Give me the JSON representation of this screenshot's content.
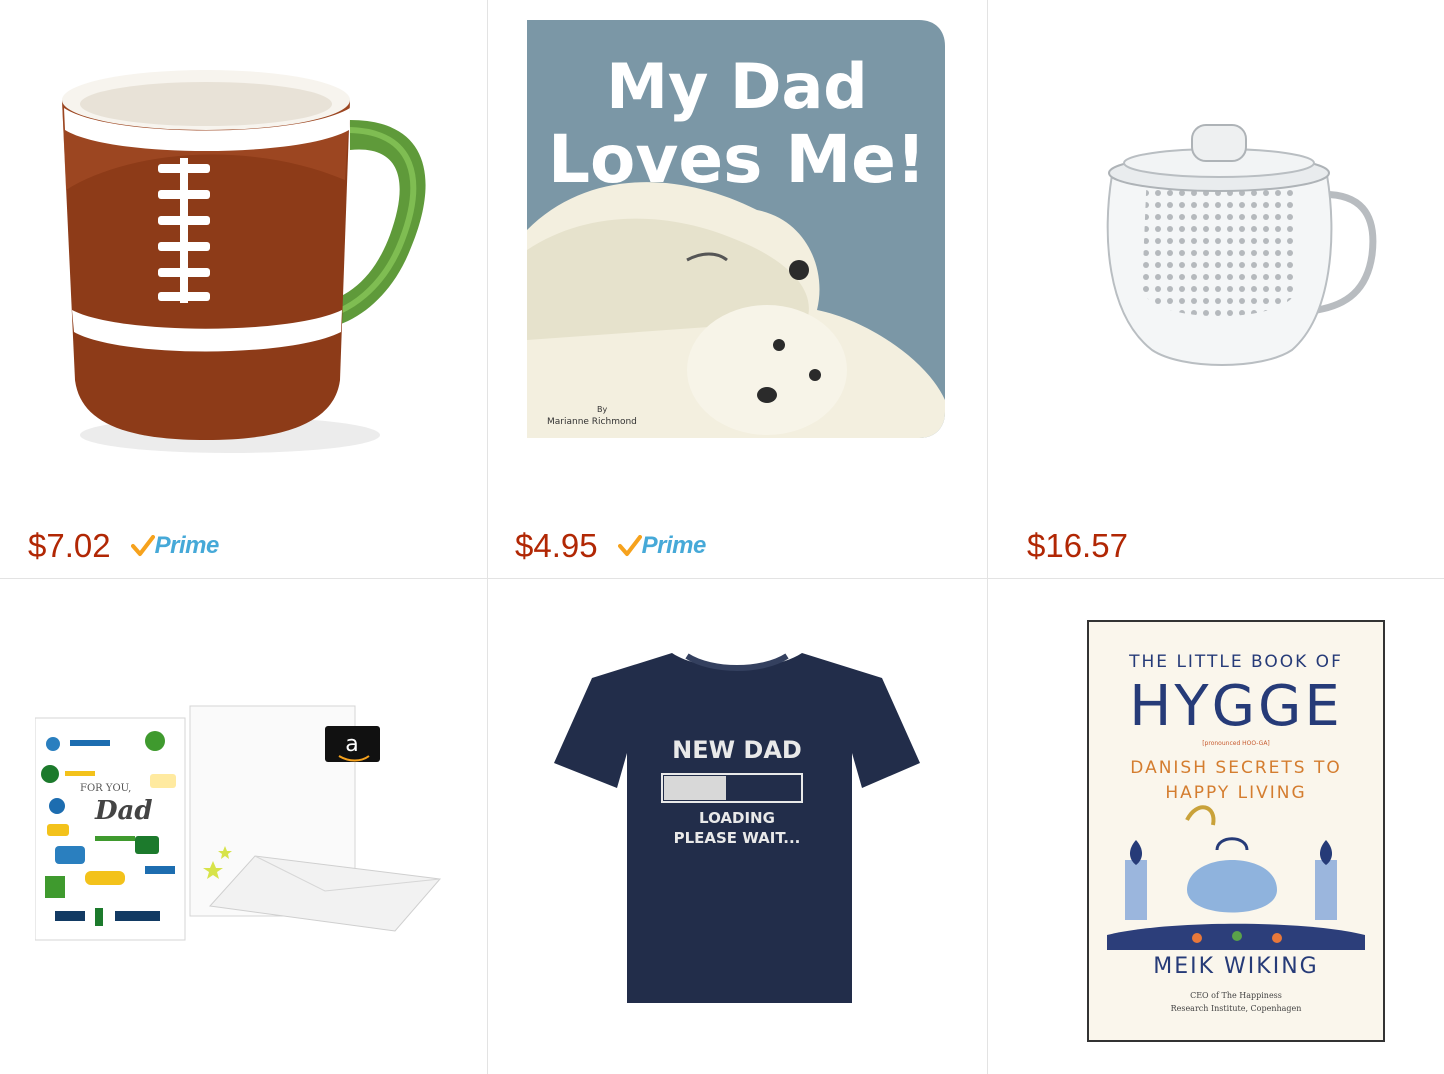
{
  "products": [
    {
      "name": "Football coffee mug",
      "price": "$7.02",
      "prime": true,
      "prime_label": "Prime"
    },
    {
      "name": "My Dad Loves Me! board book",
      "price": "$4.95",
      "prime": true,
      "prime_label": "Prime",
      "cover_title_line1": "My Dad",
      "cover_title_line2": "Loves Me!",
      "cover_by": "By",
      "cover_author": "Marianne Richmond"
    },
    {
      "name": "Glass tea infuser mug",
      "price": "$16.57",
      "prime": false
    },
    {
      "name": "Amazon gift card in greeting card",
      "card_text_line1": "FOR YOU,",
      "card_text_line2": "Dad",
      "card_logo": "a"
    },
    {
      "name": "New Dad loading t-shirt",
      "shirt_line1": "NEW DAD",
      "shirt_line2": "LOADING",
      "shirt_line3": "PLEASE WAIT..."
    },
    {
      "name": "The Little Book of Hygge",
      "book_line1": "THE LITTLE BOOK OF",
      "book_title": "HYGGE",
      "book_pron": "[pronounced HOO-GA]",
      "book_sub1": "DANISH SECRETS TO",
      "book_sub2": "HAPPY LIVING",
      "book_author": "MEIK WIKING",
      "book_credit1": "CEO of The Happiness",
      "book_credit2": "Research Institute, Copenhagen"
    }
  ],
  "colors": {
    "price": "#b12704",
    "prime_blue": "#46a9d8",
    "prime_check": "#f6a21d",
    "divider": "#e3e3e3"
  },
  "icons": [
    "prime-check-icon",
    "amazon-smile-icon"
  ]
}
